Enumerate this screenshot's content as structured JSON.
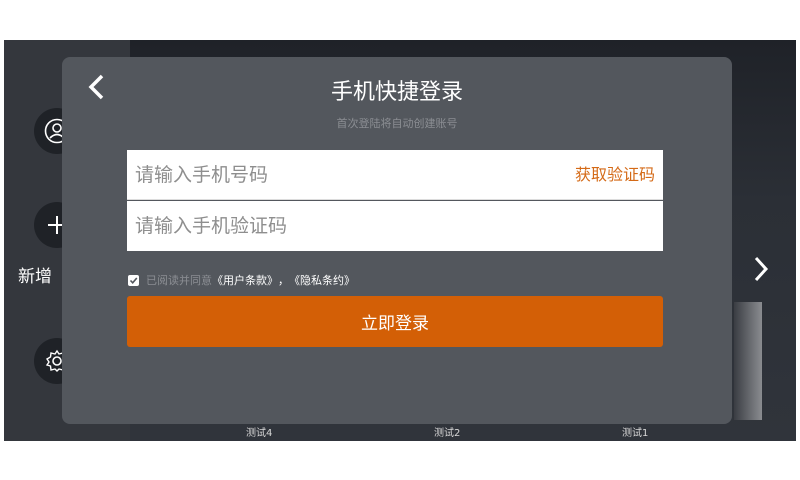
{
  "dialog": {
    "title": "手机快捷登录",
    "subtitle": "首次登陆将自动创建账号",
    "phone_placeholder": "请输入手机号码",
    "code_placeholder": "请输入手机验证码",
    "get_code_label": "获取验证码",
    "agree_text": "已阅读并同意",
    "terms_link": "《用户条款》",
    "separator": "，",
    "privacy_link": "《隐私条约》",
    "login_label": "立即登录",
    "checkbox_checked": true
  },
  "sidebar": {
    "add_label": "新增",
    "icons": [
      "user-icon",
      "plus-icon",
      "gear-icon"
    ]
  },
  "bottom_labels": [
    "测试4",
    "测试2",
    "测试1"
  ],
  "colors": {
    "accent": "#d35f06",
    "link_orange": "#d46a17",
    "dialog_bg": "#53575d",
    "screen_bg": "#2a2d33"
  }
}
